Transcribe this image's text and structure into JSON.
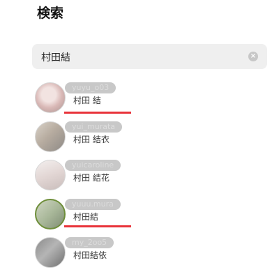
{
  "header": {
    "title": "検索"
  },
  "search": {
    "query": "村田結",
    "clear_icon": "clear-circle-icon"
  },
  "results": [
    {
      "username": "yuyu_o03",
      "full_name": "村田 結",
      "highlighted": true
    },
    {
      "username": "yui_murata",
      "full_name": "村田 結衣",
      "highlighted": false
    },
    {
      "username": "yuicaroline",
      "full_name": "村田 結花",
      "highlighted": false
    },
    {
      "username": "yuuu.mura",
      "full_name": "村田結",
      "highlighted": true
    },
    {
      "username": "my_2oo5",
      "full_name": "村田結依",
      "highlighted": false
    }
  ],
  "colors": {
    "highlight_underline": "#e8333a",
    "search_bg": "#efefef"
  }
}
